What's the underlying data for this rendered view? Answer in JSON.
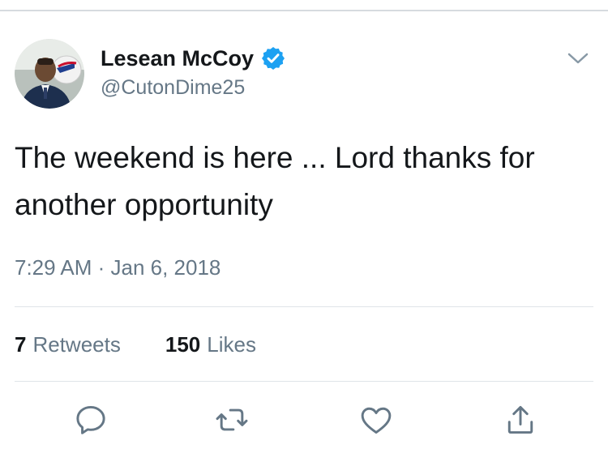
{
  "author": {
    "display_name": "Lesean McCoy",
    "handle": "@CutonDime25",
    "verified": true,
    "avatar_description": "profile photo"
  },
  "tweet": {
    "text": "The weekend is here ... Lord thanks for another opportunity",
    "timestamp": "7:29 AM · Jan 6, 2018"
  },
  "stats": {
    "retweets_count": "7",
    "retweets_label": "Retweets",
    "likes_count": "150",
    "likes_label": "Likes"
  },
  "actions": {
    "icons": [
      "reply-icon",
      "retweet-icon",
      "like-icon",
      "share-icon"
    ]
  },
  "colors": {
    "text_primary": "#14171a",
    "text_secondary": "#657786",
    "verified_blue": "#1da1f2",
    "divider": "#dfe4e8",
    "icon_gray": "#657786"
  }
}
